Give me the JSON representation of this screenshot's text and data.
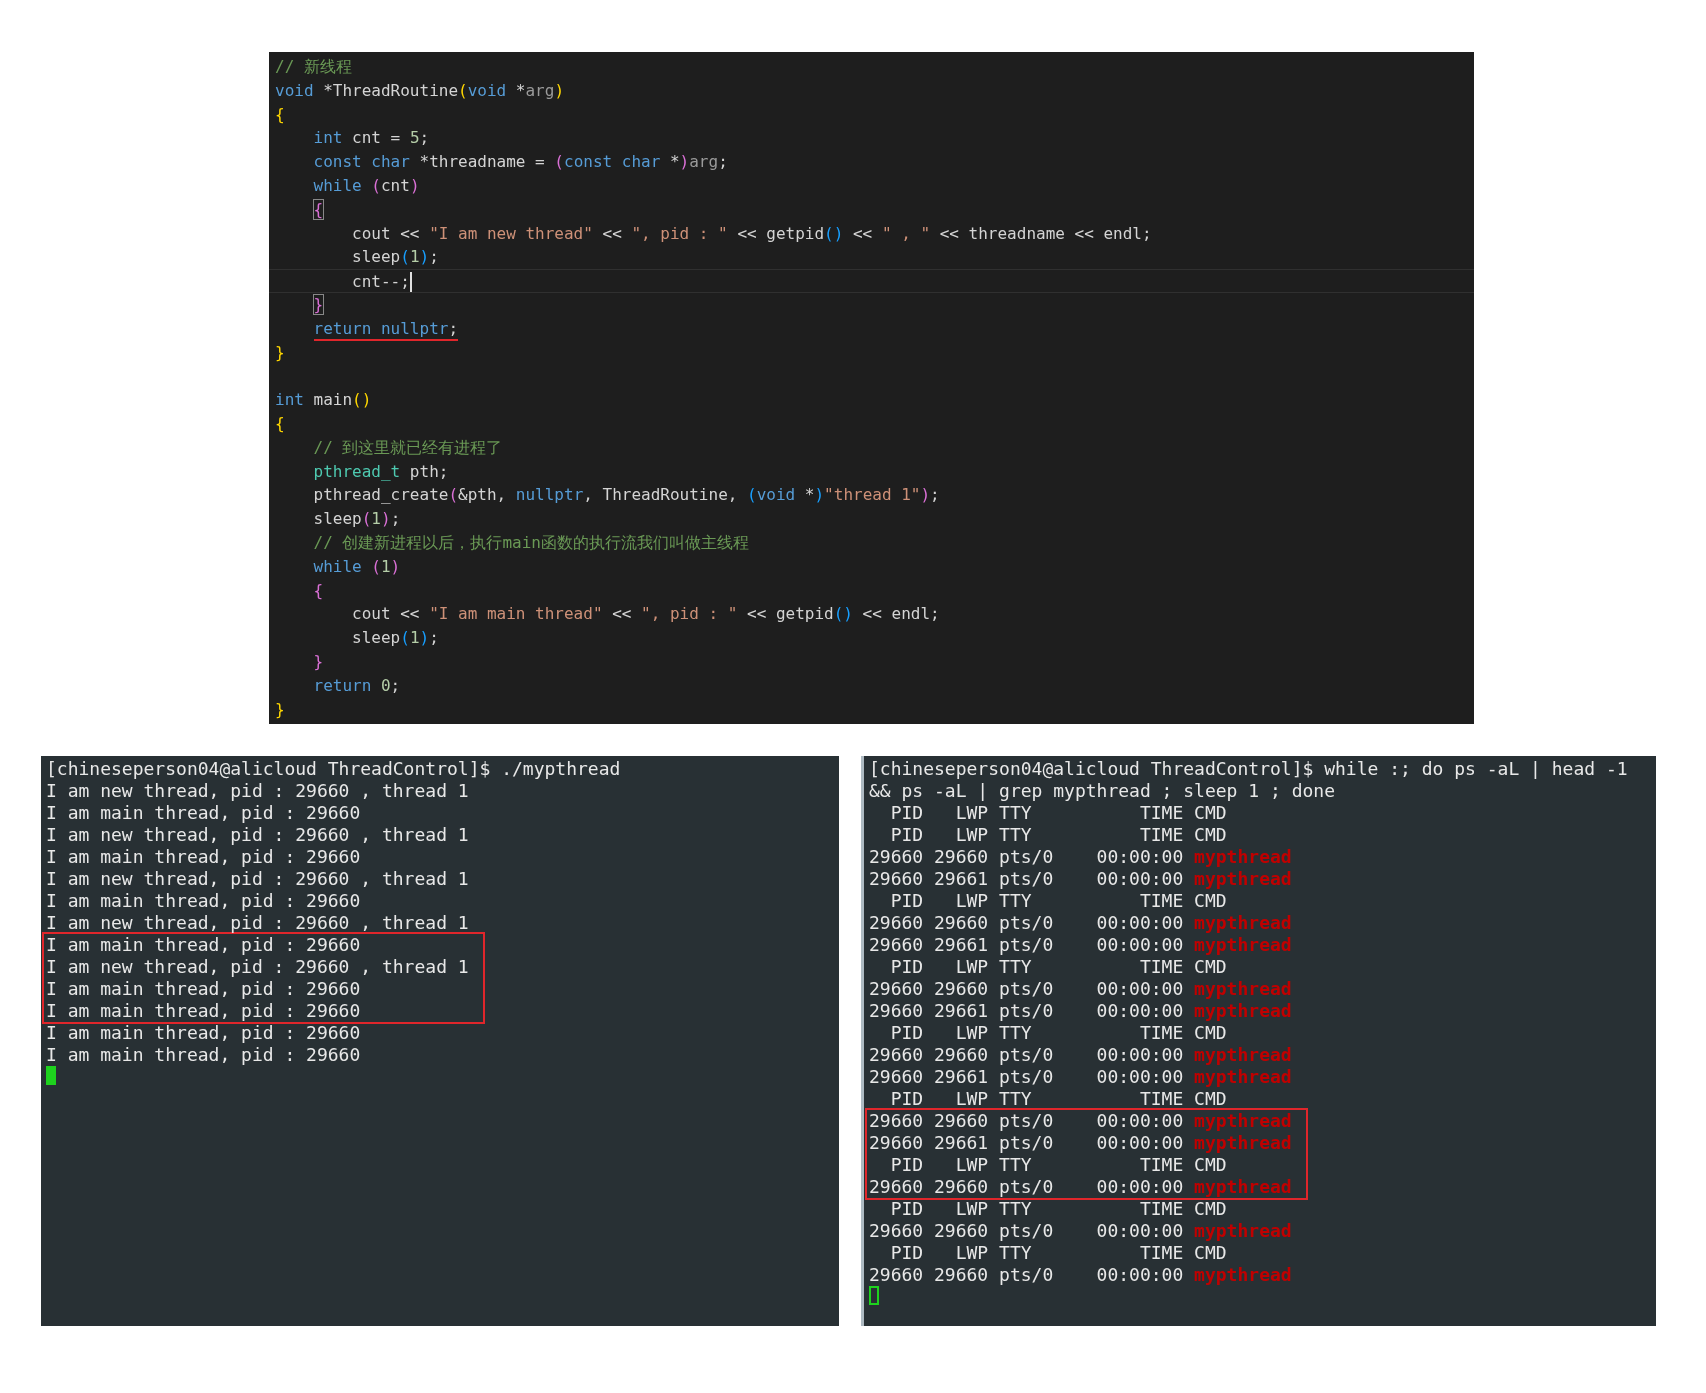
{
  "editor": {
    "lines": [
      {
        "tokens": [
          {
            "kind": "comment",
            "text": "// 新线程"
          }
        ]
      },
      {
        "tokens": [
          {
            "kind": "keyword",
            "text": "void"
          },
          {
            "kind": "plain",
            "text": " *ThreadRoutine"
          },
          {
            "kind": "bracket1",
            "text": "("
          },
          {
            "kind": "keyword",
            "text": "void"
          },
          {
            "kind": "plain",
            "text": " *"
          },
          {
            "kind": "param",
            "text": "arg"
          },
          {
            "kind": "bracket1",
            "text": ")"
          }
        ]
      },
      {
        "tokens": [
          {
            "kind": "bracket1",
            "text": "{"
          }
        ]
      },
      {
        "tokens": [
          {
            "kind": "keyword",
            "text": "    int"
          },
          {
            "kind": "plain",
            "text": " cnt = "
          },
          {
            "kind": "number",
            "text": "5"
          },
          {
            "kind": "plain",
            "text": ";"
          }
        ]
      },
      {
        "tokens": [
          {
            "kind": "keyword",
            "text": "    const char"
          },
          {
            "kind": "plain",
            "text": " *threadname = "
          },
          {
            "kind": "bracket2",
            "text": "("
          },
          {
            "kind": "keyword",
            "text": "const char"
          },
          {
            "kind": "plain",
            "text": " *"
          },
          {
            "kind": "bracket2",
            "text": ")"
          },
          {
            "kind": "param",
            "text": "arg"
          },
          {
            "kind": "plain",
            "text": ";"
          }
        ]
      },
      {
        "tokens": [
          {
            "kind": "keyword",
            "text": "    while "
          },
          {
            "kind": "bracket2",
            "text": "("
          },
          {
            "kind": "plain",
            "text": "cnt"
          },
          {
            "kind": "bracket2",
            "text": ")"
          }
        ]
      },
      {
        "tokens": [
          {
            "kind": "bracket2",
            "text": "    {",
            "matched": true
          }
        ]
      },
      {
        "tokens": [
          {
            "kind": "plain",
            "text": "        cout << "
          },
          {
            "kind": "string",
            "text": "\"I am new thread\""
          },
          {
            "kind": "plain",
            "text": " << "
          },
          {
            "kind": "string",
            "text": "\", pid : \""
          },
          {
            "kind": "plain",
            "text": " << getpid"
          },
          {
            "kind": "bracket3",
            "text": "()"
          },
          {
            "kind": "plain",
            "text": " << "
          },
          {
            "kind": "string",
            "text": "\" , \""
          },
          {
            "kind": "plain",
            "text": " << threadname << endl;"
          }
        ]
      },
      {
        "tokens": [
          {
            "kind": "plain",
            "text": "        sleep"
          },
          {
            "kind": "bracket3",
            "text": "("
          },
          {
            "kind": "number",
            "text": "1"
          },
          {
            "kind": "bracket3",
            "text": ")"
          },
          {
            "kind": "plain",
            "text": ";"
          }
        ]
      },
      {
        "current": true,
        "tokens": [
          {
            "kind": "plain",
            "text": "        cnt--;"
          }
        ]
      },
      {
        "tokens": [
          {
            "kind": "bracket2",
            "text": "    }",
            "matched": true
          }
        ]
      },
      {
        "underlined": true,
        "tokens": [
          {
            "kind": "keyword",
            "text": "    return nullptr"
          },
          {
            "kind": "plain",
            "text": ";"
          }
        ]
      },
      {
        "tokens": [
          {
            "kind": "bracket1",
            "text": "}"
          }
        ]
      },
      {
        "blank_line_before": true,
        "tokens": [
          {
            "kind": "keyword",
            "text": "int"
          },
          {
            "kind": "plain",
            "text": " main"
          },
          {
            "kind": "bracket1",
            "text": "()"
          }
        ]
      },
      {
        "tokens": [
          {
            "kind": "bracket1",
            "text": "{"
          }
        ]
      },
      {
        "tokens": [
          {
            "kind": "comment",
            "text": "    // 到这里就已经有进程了"
          }
        ]
      },
      {
        "tokens": [
          {
            "kind": "type",
            "text": "    pthread_t"
          },
          {
            "kind": "plain",
            "text": " pth;"
          }
        ]
      },
      {
        "tokens": [
          {
            "kind": "plain",
            "text": "    pthread_create"
          },
          {
            "kind": "bracket2",
            "text": "("
          },
          {
            "kind": "plain",
            "text": "&pth, "
          },
          {
            "kind": "keyword",
            "text": "nullptr"
          },
          {
            "kind": "plain",
            "text": ", ThreadRoutine, "
          },
          {
            "kind": "bracket3",
            "text": "("
          },
          {
            "kind": "keyword",
            "text": "void"
          },
          {
            "kind": "plain",
            "text": " *"
          },
          {
            "kind": "bracket3",
            "text": ")"
          },
          {
            "kind": "string",
            "text": "\"thread 1\""
          },
          {
            "kind": "bracket2",
            "text": ")"
          },
          {
            "kind": "plain",
            "text": ";"
          }
        ]
      },
      {
        "tokens": [
          {
            "kind": "plain",
            "text": "    sleep"
          },
          {
            "kind": "bracket2",
            "text": "("
          },
          {
            "kind": "number",
            "text": "1"
          },
          {
            "kind": "bracket2",
            "text": ")"
          },
          {
            "kind": "plain",
            "text": ";"
          }
        ]
      },
      {
        "tokens": [
          {
            "kind": "comment",
            "text": "    // 创建新进程以后，执行main函数的执行流我们叫做主线程"
          }
        ]
      },
      {
        "tokens": [
          {
            "kind": "keyword",
            "text": "    while "
          },
          {
            "kind": "bracket2",
            "text": "("
          },
          {
            "kind": "number",
            "text": "1"
          },
          {
            "kind": "bracket2",
            "text": ")"
          }
        ]
      },
      {
        "tokens": [
          {
            "kind": "bracket2",
            "text": "    {"
          }
        ]
      },
      {
        "tokens": [
          {
            "kind": "plain",
            "text": "        cout << "
          },
          {
            "kind": "string",
            "text": "\"I am main thread\""
          },
          {
            "kind": "plain",
            "text": " << "
          },
          {
            "kind": "string",
            "text": "\", pid : \""
          },
          {
            "kind": "plain",
            "text": " << getpid"
          },
          {
            "kind": "bracket3",
            "text": "()"
          },
          {
            "kind": "plain",
            "text": " << endl;"
          }
        ]
      },
      {
        "tokens": [
          {
            "kind": "plain",
            "text": "        sleep"
          },
          {
            "kind": "bracket3",
            "text": "("
          },
          {
            "kind": "number",
            "text": "1"
          },
          {
            "kind": "bracket3",
            "text": ")"
          },
          {
            "kind": "plain",
            "text": ";"
          }
        ]
      },
      {
        "tokens": [
          {
            "kind": "bracket2",
            "text": "    }"
          }
        ]
      },
      {
        "tokens": [
          {
            "kind": "keyword",
            "text": "    return "
          },
          {
            "kind": "number",
            "text": "0"
          },
          {
            "kind": "plain",
            "text": ";"
          }
        ]
      },
      {
        "tokens": [
          {
            "kind": "bracket1",
            "text": "}"
          }
        ]
      }
    ]
  },
  "terminals": [
    {
      "cursor_focused": true,
      "lines": [
        {
          "segments": [
            {
              "kind": "plain",
              "text": "[chineseperson04@alicloud ThreadControl]$ ./mypthread"
            }
          ]
        },
        {
          "segments": [
            {
              "kind": "plain",
              "text": "I am new thread, pid : 29660 , thread 1"
            }
          ]
        },
        {
          "segments": [
            {
              "kind": "plain",
              "text": "I am main thread, pid : 29660"
            }
          ]
        },
        {
          "segments": [
            {
              "kind": "plain",
              "text": "I am new thread, pid : 29660 , thread 1"
            }
          ]
        },
        {
          "segments": [
            {
              "kind": "plain",
              "text": "I am main thread, pid : 29660"
            }
          ]
        },
        {
          "segments": [
            {
              "kind": "plain",
              "text": "I am new thread, pid : 29660 , thread 1"
            }
          ]
        },
        {
          "segments": [
            {
              "kind": "plain",
              "text": "I am main thread, pid : 29660"
            }
          ]
        },
        {
          "segments": [
            {
              "kind": "plain",
              "text": "I am new thread, pid : 29660 , thread 1"
            }
          ]
        },
        {
          "boxed": true,
          "segments": [
            {
              "kind": "plain",
              "text": "I am main thread, pid : 29660"
            }
          ]
        },
        {
          "boxed": true,
          "segments": [
            {
              "kind": "plain",
              "text": "I am new thread, pid : 29660 , thread 1"
            }
          ]
        },
        {
          "boxed": true,
          "segments": [
            {
              "kind": "plain",
              "text": "I am main thread, pid : 29660"
            }
          ]
        },
        {
          "boxed": true,
          "segments": [
            {
              "kind": "plain",
              "text": "I am main thread, pid : 29660"
            }
          ]
        },
        {
          "segments": [
            {
              "kind": "plain",
              "text": "I am main thread, pid : 29660"
            }
          ]
        },
        {
          "segments": [
            {
              "kind": "plain",
              "text": "I am main thread, pid : 29660"
            }
          ]
        }
      ]
    },
    {
      "cursor_focused": false,
      "lines": [
        {
          "segments": [
            {
              "kind": "plain",
              "text": "[chineseperson04@alicloud ThreadControl]$ while :; do ps -aL | head -1"
            }
          ]
        },
        {
          "segments": [
            {
              "kind": "plain",
              "text": "&& ps -aL | grep mypthread ; sleep 1 ; done"
            }
          ]
        },
        {
          "segments": [
            {
              "kind": "plain",
              "text": "  PID   LWP TTY          TIME CMD"
            }
          ]
        },
        {
          "segments": [
            {
              "kind": "plain",
              "text": "  PID   LWP TTY          TIME CMD"
            }
          ]
        },
        {
          "segments": [
            {
              "kind": "plain",
              "text": "29660 29660 pts/0    00:00:00 "
            },
            {
              "kind": "match",
              "text": "mypthread"
            }
          ]
        },
        {
          "segments": [
            {
              "kind": "plain",
              "text": "29660 29661 pts/0    00:00:00 "
            },
            {
              "kind": "match",
              "text": "mypthread"
            }
          ]
        },
        {
          "segments": [
            {
              "kind": "plain",
              "text": "  PID   LWP TTY          TIME CMD"
            }
          ]
        },
        {
          "segments": [
            {
              "kind": "plain",
              "text": "29660 29660 pts/0    00:00:00 "
            },
            {
              "kind": "match",
              "text": "mypthread"
            }
          ]
        },
        {
          "segments": [
            {
              "kind": "plain",
              "text": "29660 29661 pts/0    00:00:00 "
            },
            {
              "kind": "match",
              "text": "mypthread"
            }
          ]
        },
        {
          "segments": [
            {
              "kind": "plain",
              "text": "  PID   LWP TTY          TIME CMD"
            }
          ]
        },
        {
          "segments": [
            {
              "kind": "plain",
              "text": "29660 29660 pts/0    00:00:00 "
            },
            {
              "kind": "match",
              "text": "mypthread"
            }
          ]
        },
        {
          "segments": [
            {
              "kind": "plain",
              "text": "29660 29661 pts/0    00:00:00 "
            },
            {
              "kind": "match",
              "text": "mypthread"
            }
          ]
        },
        {
          "segments": [
            {
              "kind": "plain",
              "text": "  PID   LWP TTY          TIME CMD"
            }
          ]
        },
        {
          "segments": [
            {
              "kind": "plain",
              "text": "29660 29660 pts/0    00:00:00 "
            },
            {
              "kind": "match",
              "text": "mypthread"
            }
          ]
        },
        {
          "segments": [
            {
              "kind": "plain",
              "text": "29660 29661 pts/0    00:00:00 "
            },
            {
              "kind": "match",
              "text": "mypthread"
            }
          ]
        },
        {
          "segments": [
            {
              "kind": "plain",
              "text": "  PID   LWP TTY          TIME CMD"
            }
          ]
        },
        {
          "boxed": true,
          "segments": [
            {
              "kind": "plain",
              "text": "29660 29660 pts/0    00:00:00 "
            },
            {
              "kind": "match",
              "text": "mypthread"
            }
          ]
        },
        {
          "boxed": true,
          "segments": [
            {
              "kind": "plain",
              "text": "29660 29661 pts/0    00:00:00 "
            },
            {
              "kind": "match",
              "text": "mypthread"
            }
          ]
        },
        {
          "boxed": true,
          "segments": [
            {
              "kind": "plain",
              "text": "  PID   LWP TTY          TIME CMD"
            }
          ]
        },
        {
          "boxed": true,
          "segments": [
            {
              "kind": "plain",
              "text": "29660 29660 pts/0    00:00:00 "
            },
            {
              "kind": "match",
              "text": "mypthread"
            }
          ]
        },
        {
          "segments": [
            {
              "kind": "plain",
              "text": "  PID   LWP TTY          TIME CMD"
            }
          ]
        },
        {
          "segments": [
            {
              "kind": "plain",
              "text": "29660 29660 pts/0    00:00:00 "
            },
            {
              "kind": "match",
              "text": "mypthread"
            }
          ]
        },
        {
          "segments": [
            {
              "kind": "plain",
              "text": "  PID   LWP TTY          TIME CMD"
            }
          ]
        },
        {
          "segments": [
            {
              "kind": "plain",
              "text": "29660 29660 pts/0    00:00:00 "
            },
            {
              "kind": "match",
              "text": "mypthread"
            }
          ]
        }
      ]
    }
  ]
}
